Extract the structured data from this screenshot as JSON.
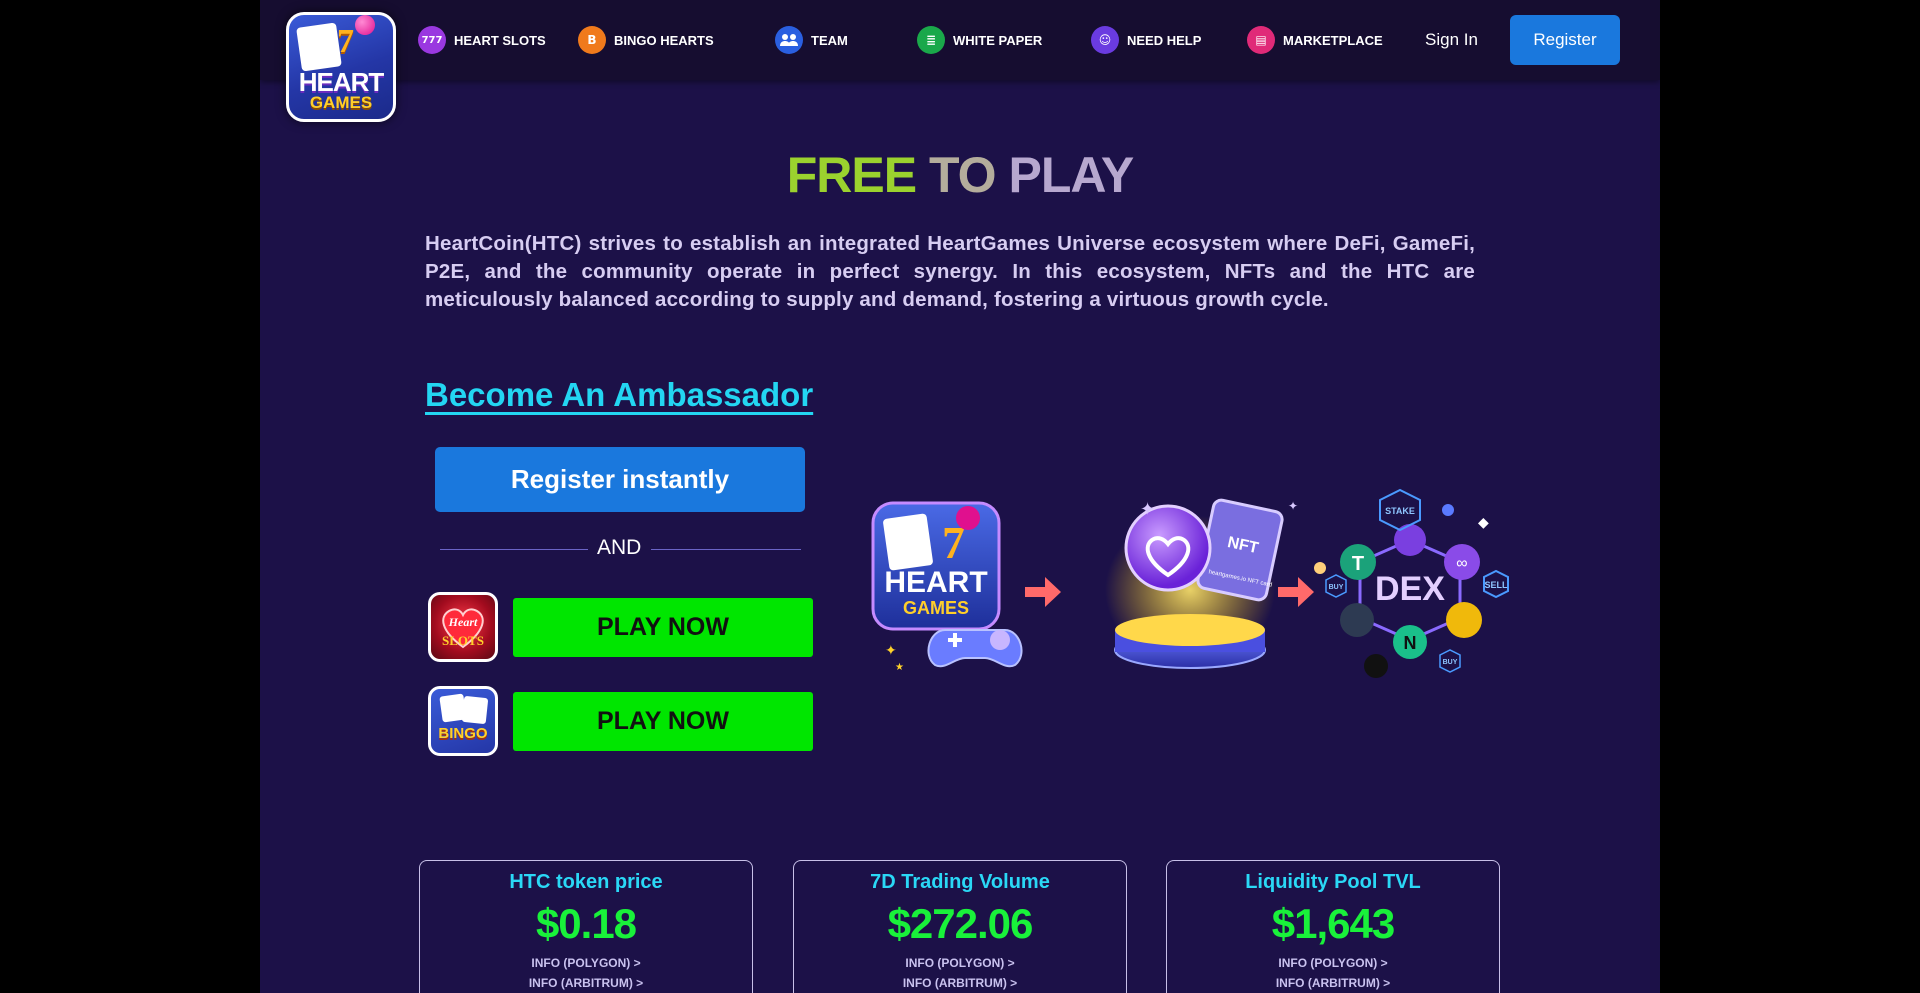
{
  "header": {
    "logo": {
      "line1": "HEART",
      "line2": "GAMES"
    },
    "nav": [
      {
        "label": "HEART SLOTS",
        "icon": "777-icon",
        "icon_text": "777",
        "color": "#9a38e0"
      },
      {
        "label": "BINGO HEARTS",
        "icon": "bitcoin-icon",
        "icon_text": "B",
        "color": "#f07a1c"
      },
      {
        "label": "TEAM",
        "icon": "team-icon",
        "icon_text": "👥",
        "color": "#2a5fe0"
      },
      {
        "label": "WHITE PAPER",
        "icon": "document-icon",
        "icon_text": "≣",
        "color": "#1aa84a"
      },
      {
        "label": "NEED HELP",
        "icon": "support-icon",
        "icon_text": "☺",
        "color": "#6a3be0"
      },
      {
        "label": "MARKETPLACE",
        "icon": "store-icon",
        "icon_text": "▤",
        "color": "#e02a78"
      }
    ],
    "signin_label": "Sign In",
    "register_label": "Register"
  },
  "hero": {
    "title_part1": "FREE",
    "title_part2": "TO",
    "title_part3": "PLAY",
    "intro": "HeartCoin(HTC) strives to establish an integrated HeartGames Universe ecosystem where DeFi, GameFi, P2E, and the community operate in perfect synergy. In this ecosystem, NFTs and the HTC are meticulously balanced according to supply and demand, fostering a virtuous growth cycle."
  },
  "ambassador": {
    "title": "Become An Ambassador",
    "register_label": "Register instantly",
    "and_label": "AND",
    "games": [
      {
        "name": "slots",
        "icon_text": "SLOTS",
        "play_label": "PLAY NOW"
      },
      {
        "name": "bingo",
        "icon_text": "BINGO",
        "play_label": "PLAY NOW"
      }
    ]
  },
  "illustration": {
    "logo_line1": "HEART",
    "logo_line2": "GAMES",
    "nft_label": "NFT",
    "nft_card_text": "heartgames.io NFT card",
    "dex_label": "DEX",
    "stake_label": "STAKE",
    "sell_label": "SELL",
    "buy_label": "BUY"
  },
  "stats": [
    {
      "label": "HTC token price",
      "value": "$0.18",
      "info1": "INFO (POLYGON) >",
      "info2": "INFO (ARBITRUM) >"
    },
    {
      "label": "7D Trading Volume",
      "value": "$272.06",
      "info1": "INFO (POLYGON) >",
      "info2": "INFO (ARBITRUM) >"
    },
    {
      "label": "Liquidity Pool TVL",
      "value": "$1,643",
      "info1": "INFO (POLYGON) >",
      "info2": "INFO (ARBITRUM) >"
    }
  ]
}
